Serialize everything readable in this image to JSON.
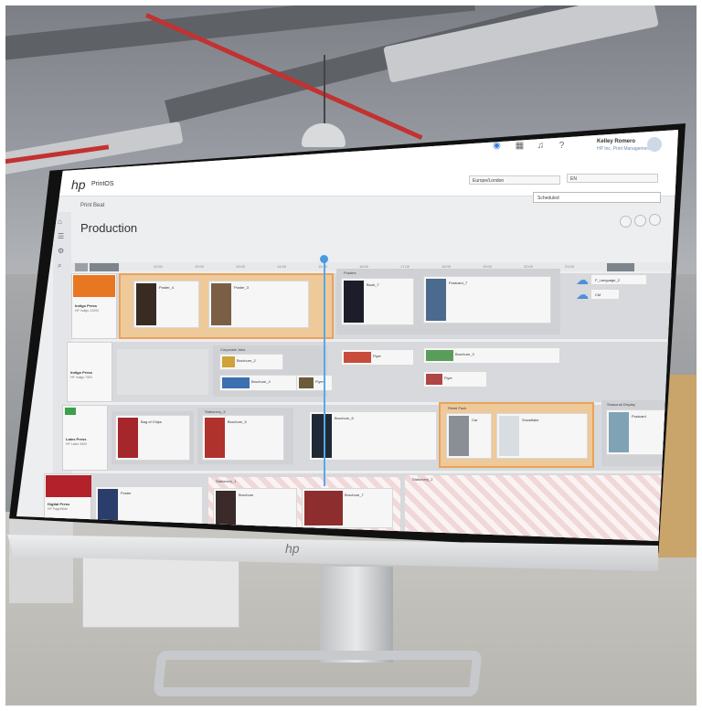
{
  "scene": {
    "description_colors": {
      "ceiling": "#8a8e93",
      "floor": "#c2c1bc",
      "accent_orange": "#e9a35a",
      "accent_blue": "#4a90d9",
      "accent_red": "#c33131"
    }
  },
  "topbar": {
    "user_name": "Kelley Romero",
    "user_role": "HP Inc. Print Management",
    "icons": [
      "notification-toggle-icon",
      "calendar-icon",
      "bell-icon",
      "help-icon"
    ]
  },
  "appbar": {
    "app_name": "PrintOS",
    "dropdown_1": "Europe/London",
    "dropdown_2": "EN"
  },
  "breadcrumb": "Print Beat",
  "page_title": "Production",
  "search_value": "Scheduled",
  "ruler_ticks": [
    "11:00",
    "12:00",
    "13:00",
    "14:00",
    "15:00",
    "16:00",
    "17:00",
    "18:00",
    "19:00",
    "20:00",
    "21:00",
    "22:00",
    "23:00"
  ],
  "lanes": [
    {
      "name": "Indigo Press",
      "sub": "HP Indigo 12000"
    },
    {
      "name": "Indigo Press",
      "sub": "HP Indigo 7900"
    },
    {
      "name": "Latex Press",
      "sub": "HP Latex 3600"
    },
    {
      "name": "Digital Press",
      "sub": "HP PageWide"
    }
  ],
  "blocks": [
    {
      "label": "Stationery_1"
    },
    {
      "label": "Stationery_2"
    },
    {
      "label": "Corporate Jobs"
    },
    {
      "label": "Posters"
    },
    {
      "label": "Stationery_3"
    },
    {
      "label": "Retail Pack"
    },
    {
      "label": "Seasonal Display"
    }
  ],
  "items": [
    {
      "label": "Poster_4"
    },
    {
      "label": "Poster_3"
    },
    {
      "label": "Book_7"
    },
    {
      "label": "Postcard_7"
    },
    {
      "label": "Brochure_2"
    },
    {
      "label": "Flyer"
    },
    {
      "label": "Brochure_3"
    },
    {
      "label": "Brochure_4"
    },
    {
      "label": "Flyer"
    },
    {
      "label": "Flyer"
    },
    {
      "label": "Brochure"
    },
    {
      "label": "Bag of Chips"
    },
    {
      "label": "Brochure_5"
    },
    {
      "label": "Brochure_6"
    },
    {
      "label": "Car"
    },
    {
      "label": "Snowflake"
    },
    {
      "label": "Postcard"
    },
    {
      "label": "Poster"
    },
    {
      "label": "Brochure_7"
    }
  ],
  "cloud_items": [
    {
      "label": "F_Language_2"
    },
    {
      "label": "CM"
    }
  ]
}
